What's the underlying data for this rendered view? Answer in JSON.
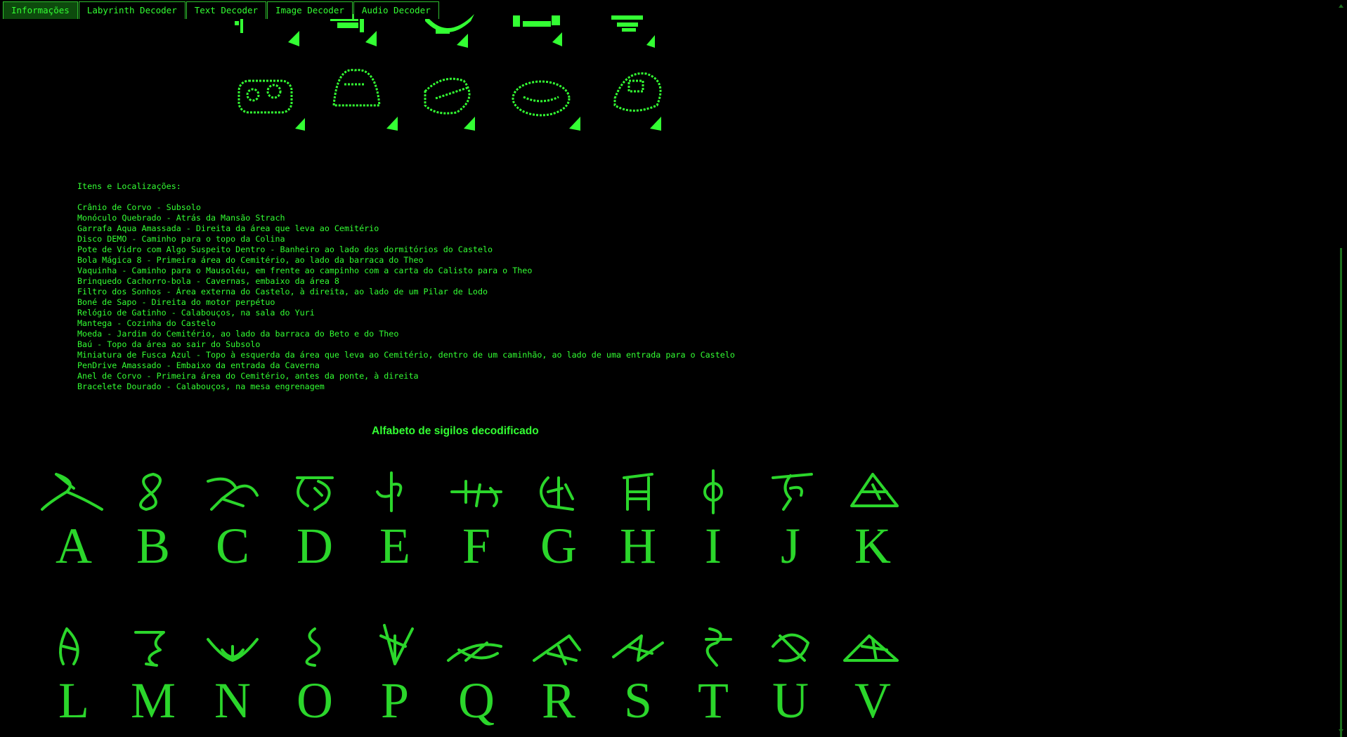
{
  "tabs": [
    {
      "label": "Informações",
      "active": true
    },
    {
      "label": "Labyrinth Decoder",
      "active": false
    },
    {
      "label": "Text Decoder",
      "active": false
    },
    {
      "label": "Image Decoder",
      "active": false
    },
    {
      "label": "Audio Decoder",
      "active": false
    }
  ],
  "items_section": {
    "heading": "Itens e Localizações:",
    "items": [
      "Crânio de Corvo - Subsolo",
      "Monóculo Quebrado - Atrás da Mansão Strach",
      "Garrafa Aqua Amassada - Direita da área que leva ao Cemitério",
      "Disco DEMO - Caminho para o topo da Colina",
      "Pote de Vidro com Algo Suspeito Dentro - Banheiro ao lado dos dormitórios do Castelo",
      "Bola Mágica 8 - Primeira área do Cemitério, ao lado da barraca do Theo",
      "Vaquinha - Caminho para o Mausoléu, em frente ao campinho com a carta do Calisto para o Theo",
      "Brinquedo Cachorro-bola - Cavernas, embaixo da área 8",
      "Filtro dos Sonhos - Área externa do Castelo, à direita, ao lado de um Pilar de Lodo",
      "Boné de Sapo - Direita do motor perpétuo",
      "Relógio de Gatinho - Calabouços, na sala do Yuri",
      "Mantega - Cozinha do Castelo",
      "Moeda - Jardim do Cemitério, ao lado da barraca do Beto e do Theo",
      "Baú - Topo da área ao sair do Subsolo",
      "Miniatura de Fusca Azul - Topo à esquerda da área que leva ao Cemitério, dentro de um caminhão, ao lado de uma entrada para o Castelo",
      "PenDrive Amassado - Embaixo da entrada da Caverna",
      "Anel de Corvo - Primeira área do Cemitério, antes da ponte, à direita",
      "Bracelete Dourado - Calabouços, na mesa engrenagem"
    ]
  },
  "alphabet_section": {
    "title": "Alfabeto de sigilos decodificado",
    "rows": [
      [
        "A",
        "B",
        "C",
        "D",
        "E",
        "F",
        "G",
        "H",
        "I",
        "J",
        "K"
      ],
      [
        "L",
        "M",
        "N",
        "O",
        "P",
        "Q",
        "R",
        "S",
        "T",
        "U",
        "V"
      ]
    ]
  },
  "colors": {
    "background": "#000000",
    "text": "#33ff33",
    "tab_active_bg": "#0d4a0d",
    "tab_border": "#2fbf2f"
  }
}
